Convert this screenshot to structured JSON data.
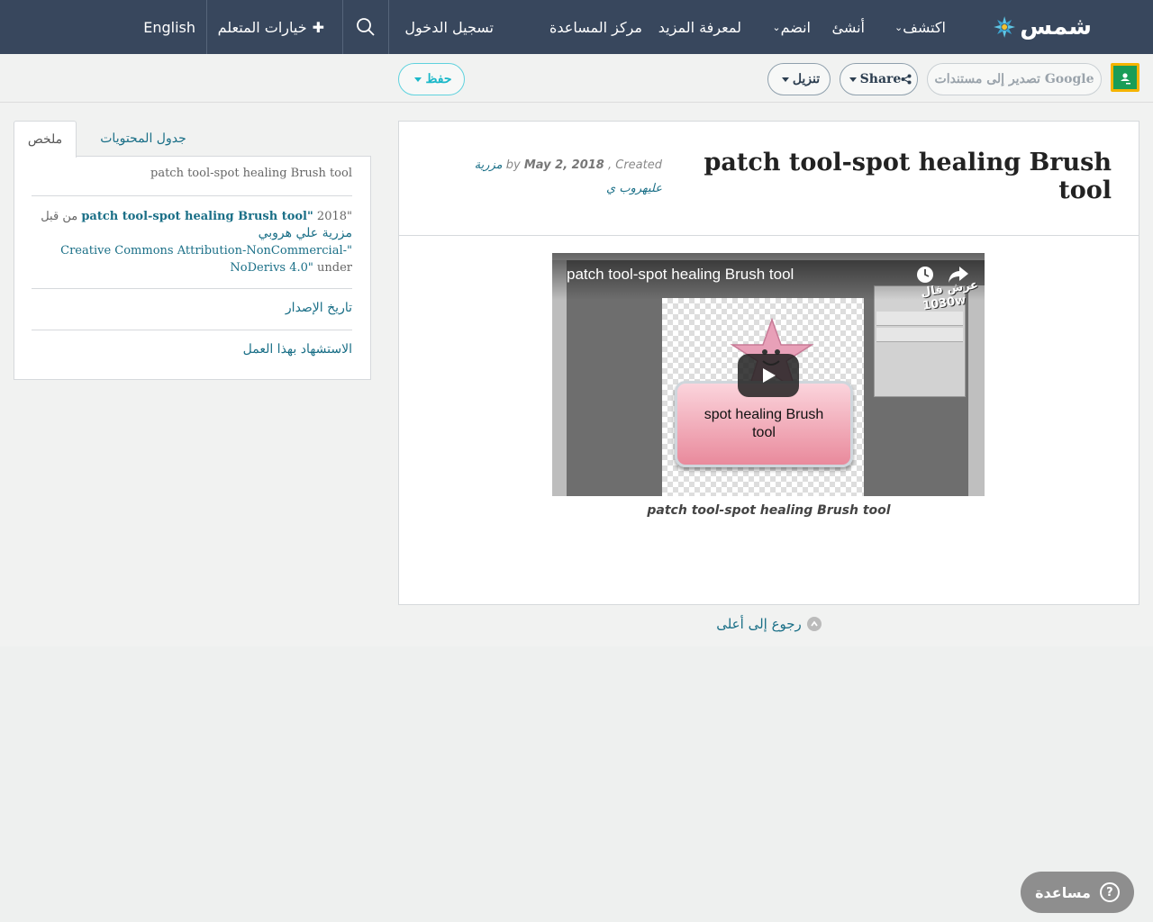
{
  "nav": {
    "logo_text": "شمس",
    "explore": "اكتشف",
    "create": "أنشئ",
    "join": "انضم",
    "learn_more": "لمعرفة المزيد",
    "help_center": "مركز المساعدة",
    "login": "تسجيل الدخول",
    "learner_options": "خيارات المتعلم",
    "language": "English"
  },
  "toolbar": {
    "export_google": "تصدير إلى مستندات Google",
    "share": "Share",
    "download": "تنزيل",
    "save": "حفظ"
  },
  "resource": {
    "title": "patch tool-spot healing Brush tool",
    "meta_by": "by",
    "author": "مزرية عليهروب ي",
    "meta_created": ", Created",
    "date": "May 2, 2018",
    "video_title": "patch tool-spot healing Brush tool",
    "video_button_text": "spot healing Brush tool",
    "channel_logo": "عرش فال 1030w",
    "caption": "patch tool-spot healing Brush tool"
  },
  "back_to_top": "رجوع إلى أعلى",
  "sidebar": {
    "tab_summary": "ملخص",
    "tab_toc": "جدول المحتويات",
    "summary_title": "patch tool-spot healing Brush tool",
    "citation_quote_open": "\"",
    "citation_title": "patch tool-spot healing Brush tool",
    "citation_quote_close": "\"",
    "citation_year": "2018",
    "citation_by": "من قبل",
    "citation_author": "مزرية علي هروبي",
    "citation_under": "under",
    "license": "\"Creative Commons Attribution-NonCommercial-NoDerivs 4.0\"",
    "version_history": "تاريخ الإصدار",
    "cite_this": "الاستشهاد بهذا العمل"
  },
  "help_button": "مساعدة",
  "colors": {
    "nav_bg": "#38475d",
    "link": "#1a6f87",
    "teal": "#1bb8c9"
  }
}
